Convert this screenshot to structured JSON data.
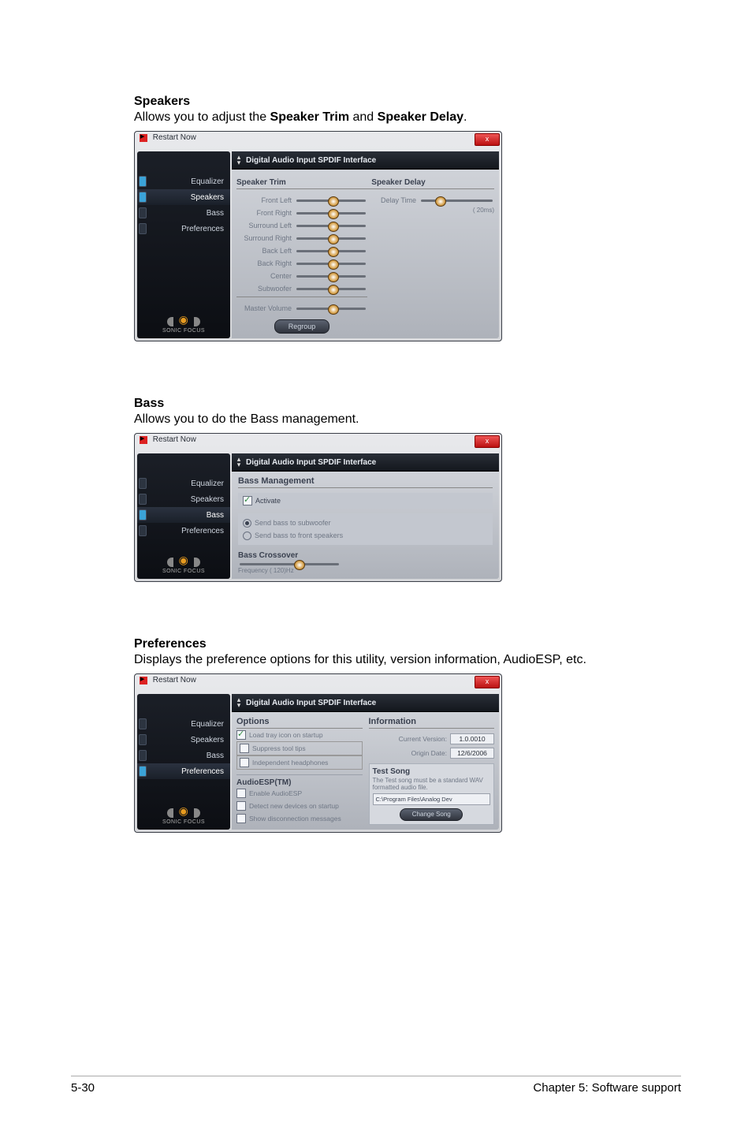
{
  "sections": {
    "speakers": {
      "heading": "Speakers",
      "desc_pre": "Allows you to adjust the ",
      "bold1": "Speaker Trim",
      "mid": " and ",
      "bold2": "Speaker Delay",
      "post": "."
    },
    "bass": {
      "heading": "Bass",
      "desc": "Allows you to do the Bass management."
    },
    "preferences": {
      "heading": "Preferences",
      "desc": "Displays the preference options for this utility, version information, AudioESP, etc."
    }
  },
  "common": {
    "window_title": "Restart Now",
    "close": "x",
    "tabbar": "Digital Audio Input SPDIF Interface",
    "tabs": {
      "equalizer": "Equalizer",
      "speakers": "Speakers",
      "bass": "Bass",
      "preferences": "Preferences"
    },
    "logo": "SONIC FOCUS"
  },
  "speakers_panel": {
    "trim_head": "Speaker Trim",
    "delay_head": "Speaker Delay",
    "channels": [
      "Front Left",
      "Front Right",
      "Surround Left",
      "Surround Right",
      "Back Left",
      "Back Right",
      "Center",
      "Subwoofer"
    ],
    "master": "Master Volume",
    "regroup": "Regroup",
    "delay_label": "Delay Time",
    "delay_value": "( 20ms)"
  },
  "bass_panel": {
    "head": "Bass Management",
    "activate": "Activate",
    "r1": "Send bass to subwoofer",
    "r2": "Send bass to front speakers",
    "cross_head": "Bass Crossover",
    "freq": "Frequency  ( 120)Hz"
  },
  "pref_panel": {
    "options_head": "Options",
    "info_head": "Information",
    "opt_load": "Load tray icon on startup",
    "opt_suppress": "Suppress tool tips",
    "opt_indep": "Independent headphones",
    "esp_head": "AudioESP(TM)",
    "esp_enable": "Enable AudioESP",
    "esp_detect": "Detect new devices on startup",
    "esp_discon": "Show disconnection messages",
    "ver_label": "Current Version:",
    "ver_value": "1.0.0010",
    "date_label": "Origin Date:",
    "date_value": "12/6/2006",
    "test_head": "Test Song",
    "test_desc": "The Test song must be a standard WAV formatted audio file.",
    "test_path": "C:\\Program Files\\Analog Dev",
    "change": "Change Song"
  },
  "footer": {
    "left": "5-30",
    "right": "Chapter 5: Software support"
  }
}
